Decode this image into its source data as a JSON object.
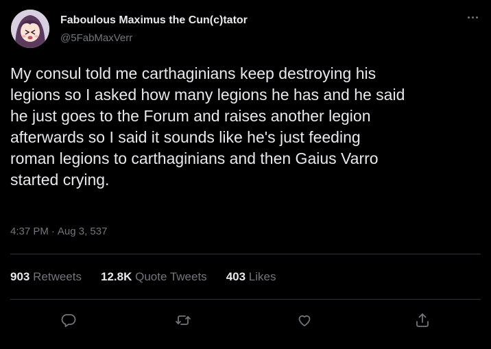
{
  "author": {
    "display_name": "Faboulous Maximus the Cun(c)tator",
    "handle": "@5FabMaxVerr"
  },
  "tweet": {
    "text": "My consul told me carthaginians keep destroying his\nlegions so I asked how many legions he has and he said\nhe just goes to the Forum and raises another legion\nafterwards so I said it sounds like he's just feeding\nroman legions to carthaginians and then Gaius Varro\nstarted crying.",
    "time": "4:37 PM",
    "separator": "·",
    "date": "Aug 3, 537"
  },
  "stats": {
    "retweets_count": "903",
    "retweets_label": "Retweets",
    "quotes_count": "12.8K",
    "quotes_label": "Quote Tweets",
    "likes_count": "403",
    "likes_label": "Likes"
  },
  "icons": {
    "more": "more-icon",
    "reply": "reply-icon",
    "retweet": "retweet-icon",
    "like": "like-icon",
    "share": "share-icon"
  },
  "colors": {
    "background": "#000000",
    "text_primary": "#e7e9ea",
    "text_secondary": "#71767b",
    "divider": "#2f3336"
  }
}
